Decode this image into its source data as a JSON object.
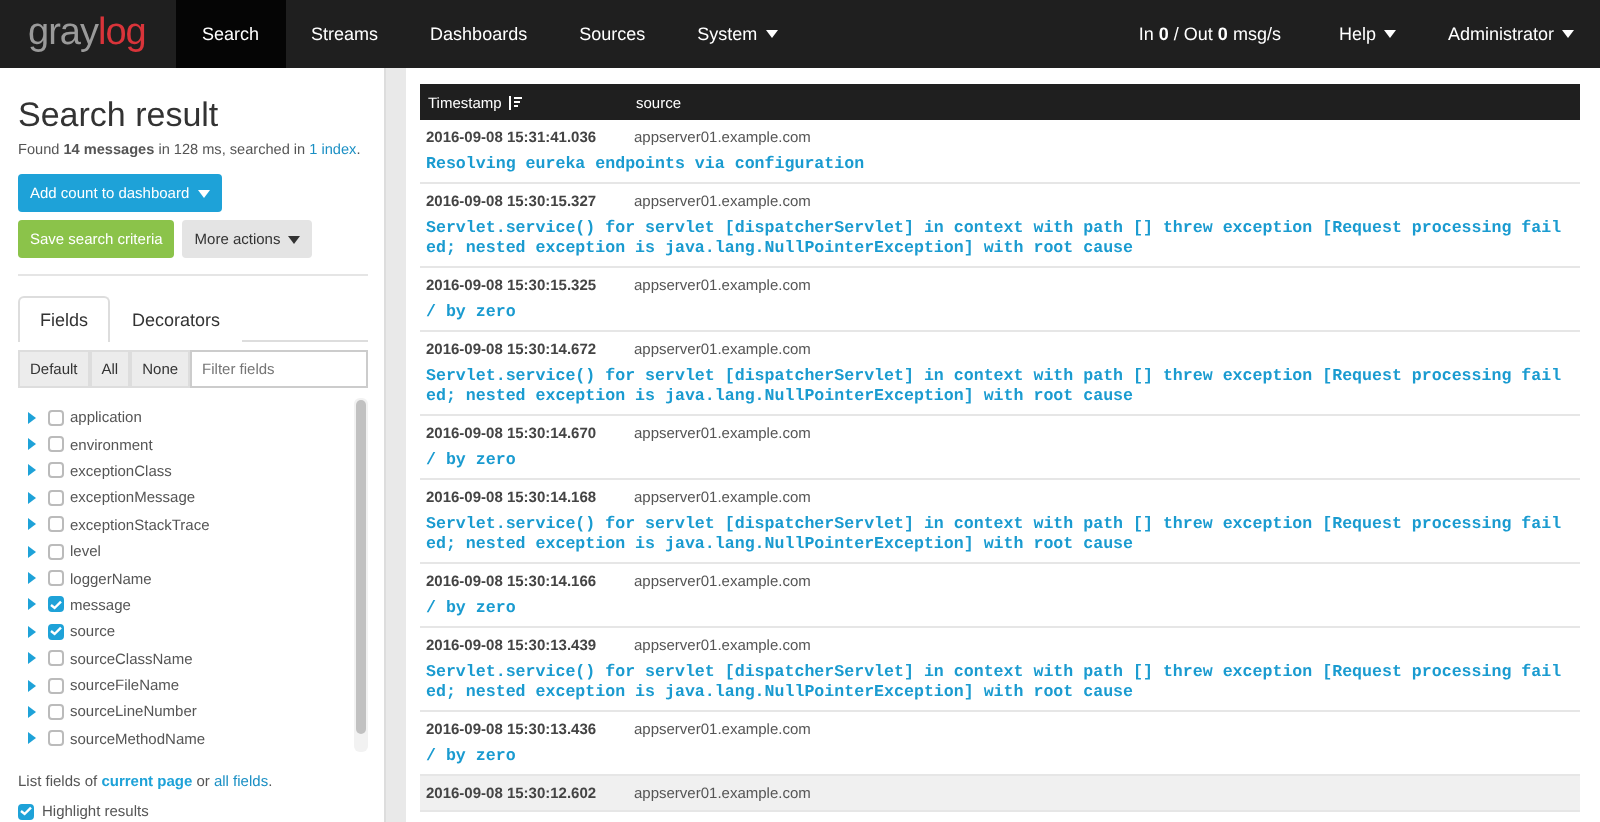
{
  "navbar": {
    "logo_parts": [
      "gray",
      "log"
    ],
    "items": [
      {
        "label": "Search",
        "selected": true,
        "dropdown": false
      },
      {
        "label": "Streams",
        "selected": false,
        "dropdown": false
      },
      {
        "label": "Dashboards",
        "selected": false,
        "dropdown": false
      },
      {
        "label": "Sources",
        "selected": false,
        "dropdown": false
      },
      {
        "label": "System",
        "selected": false,
        "dropdown": true
      }
    ],
    "throughput": {
      "in_label": "In",
      "in_value": "0",
      "out_label": "/ Out",
      "out_value": "0",
      "unit": "msg/s"
    },
    "right_items": [
      {
        "label": "Help"
      },
      {
        "label": "Administrator"
      }
    ]
  },
  "sidebar": {
    "title": "Search result",
    "summary_before": "Found **14 messages**  in 128 ms, searched in ",
    "summary_link": "1 index",
    "summary_after": ".",
    "buttons": [
      {
        "label": "Add count to dashboard",
        "kind": "primary",
        "dropdown": true
      },
      {
        "label": "Save search criteria",
        "kind": "success",
        "dropdown": false
      },
      {
        "label": "More actions",
        "kind": "default",
        "dropdown": true
      }
    ],
    "tabs": [
      {
        "label": "Fields",
        "selected": true
      },
      {
        "label": "Decorators",
        "selected": false
      }
    ],
    "filter_buttons": [
      "Default",
      "All",
      "None"
    ],
    "filter": {
      "placeholder": "Filter fields"
    },
    "fields": [
      {
        "name": "application",
        "checked": false
      },
      {
        "name": "environment",
        "checked": false
      },
      {
        "name": "exceptionClass",
        "checked": false
      },
      {
        "name": "exceptionMessage",
        "checked": false
      },
      {
        "name": "exceptionStackTrace",
        "checked": false
      },
      {
        "name": "level",
        "checked": false
      },
      {
        "name": "loggerName",
        "checked": false
      },
      {
        "name": "message",
        "checked": true
      },
      {
        "name": "source",
        "checked": true
      },
      {
        "name": "sourceClassName",
        "checked": false
      },
      {
        "name": "sourceFileName",
        "checked": false
      },
      {
        "name": "sourceLineNumber",
        "checked": false
      },
      {
        "name": "sourceMethodName",
        "checked": false
      }
    ],
    "list_text": "List fields of ",
    "list_link_1": "current page",
    "list_or": " or ",
    "list_link_2": "all fields",
    "list_end": ".",
    "highlight": {
      "label": "Highlight results",
      "checked": true
    }
  },
  "table": {
    "columns": [
      "Timestamp",
      "source"
    ],
    "rows": [
      {
        "timestamp": "2016-09-08 15:31:41.036",
        "source": "appserver01.example.com",
        "message": "Resolving eureka endpoints via configuration",
        "highlighted": false
      },
      {
        "timestamp": "2016-09-08 15:30:15.327",
        "source": "appserver01.example.com",
        "message": "Servlet.service() for servlet [dispatcherServlet] in context with path [] threw exception [Request processing failed; nested exception is java.lang.NullPointerException] with root cause",
        "highlighted": false
      },
      {
        "timestamp": "2016-09-08 15:30:15.325",
        "source": "appserver01.example.com",
        "message": "/ by zero",
        "highlighted": false
      },
      {
        "timestamp": "2016-09-08 15:30:14.672",
        "source": "appserver01.example.com",
        "message": "Servlet.service() for servlet [dispatcherServlet] in context with path [] threw exception [Request processing failed; nested exception is java.lang.NullPointerException] with root cause",
        "highlighted": false
      },
      {
        "timestamp": "2016-09-08 15:30:14.670",
        "source": "appserver01.example.com",
        "message": "/ by zero",
        "highlighted": false
      },
      {
        "timestamp": "2016-09-08 15:30:14.168",
        "source": "appserver01.example.com",
        "message": "Servlet.service() for servlet [dispatcherServlet] in context with path [] threw exception [Request processing failed; nested exception is java.lang.NullPointerException] with root cause",
        "highlighted": false
      },
      {
        "timestamp": "2016-09-08 15:30:14.166",
        "source": "appserver01.example.com",
        "message": "/ by zero",
        "highlighted": false
      },
      {
        "timestamp": "2016-09-08 15:30:13.439",
        "source": "appserver01.example.com",
        "message": "Servlet.service() for servlet [dispatcherServlet] in context with path [] threw exception [Request processing failed; nested exception is java.lang.NullPointerException] with root cause",
        "highlighted": false
      },
      {
        "timestamp": "2016-09-08 15:30:13.436",
        "source": "appserver01.example.com",
        "message": "/ by zero",
        "highlighted": false
      },
      {
        "timestamp": "2016-09-08 15:30:12.602",
        "source": "appserver01.example.com",
        "highlighted": true
      }
    ]
  }
}
